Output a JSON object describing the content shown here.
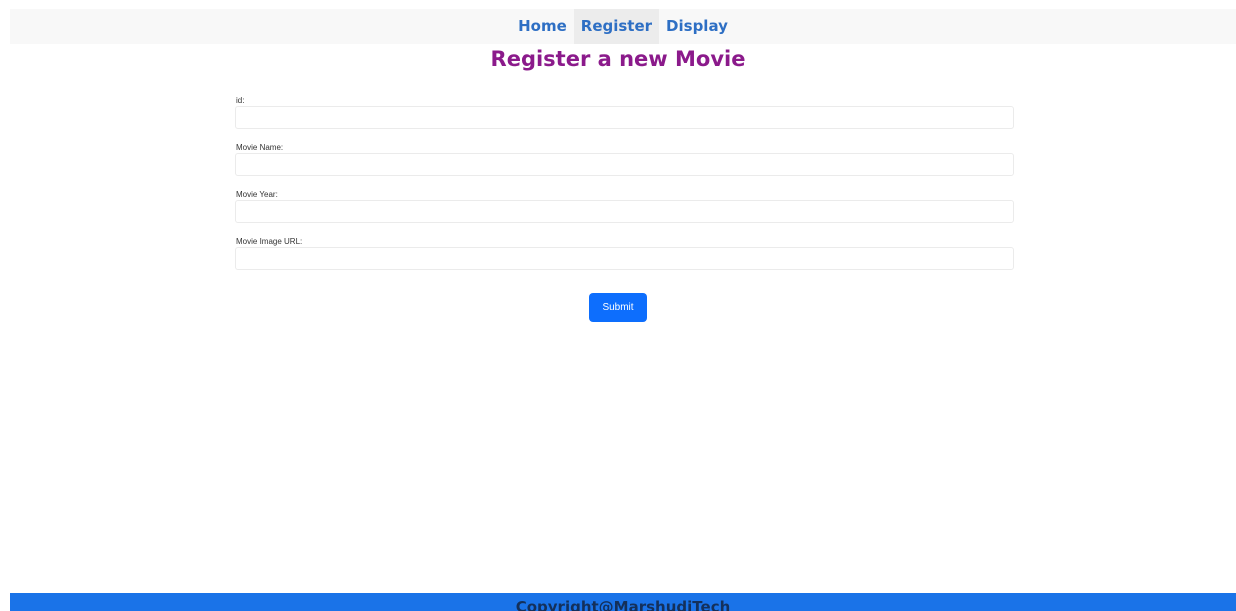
{
  "nav": {
    "items": [
      {
        "label": "Home"
      },
      {
        "label": "Register"
      },
      {
        "label": "Display"
      }
    ]
  },
  "page": {
    "title": "Register a new Movie"
  },
  "form": {
    "fields": [
      {
        "label": "id:",
        "value": "",
        "placeholder": ""
      },
      {
        "label": "Movie Name:",
        "value": "",
        "placeholder": ""
      },
      {
        "label": "Movie Year:",
        "value": "",
        "placeholder": ""
      },
      {
        "label": "Movie Image URL:",
        "value": "",
        "placeholder": ""
      }
    ],
    "submit_label": "Submit"
  },
  "footer": {
    "text": "Copyright@MarshudiTech"
  },
  "colors": {
    "nav_link": "#2e6fc4",
    "title": "#8b1a8b",
    "button": "#0d6efd",
    "footer_bg": "#1a73e8",
    "footer_text": "#14305a"
  }
}
